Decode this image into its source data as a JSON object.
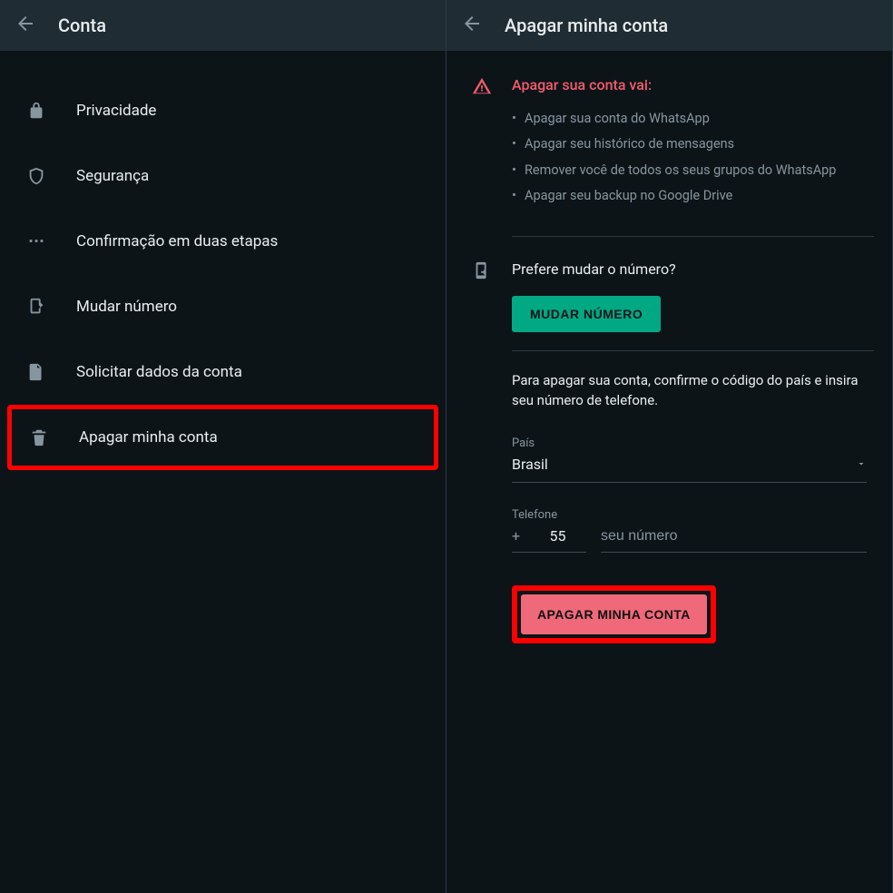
{
  "left": {
    "title": "Conta",
    "items": [
      {
        "label": "Privacidade",
        "icon": "lock-icon"
      },
      {
        "label": "Segurança",
        "icon": "shield-icon"
      },
      {
        "label": "Confirmação em duas etapas",
        "icon": "pin-icon"
      },
      {
        "label": "Mudar número",
        "icon": "send-phone-icon"
      },
      {
        "label": "Solicitar dados da conta",
        "icon": "document-icon"
      },
      {
        "label": "Apagar minha conta",
        "icon": "trash-icon"
      }
    ]
  },
  "right": {
    "title": "Apagar minha conta",
    "warning": {
      "heading": "Apagar sua conta vai:",
      "bullets": [
        "Apagar sua conta do WhatsApp",
        "Apagar seu histórico de mensagens",
        "Remover você de todos os seus grupos do WhatsApp",
        "Apagar seu backup no Google Drive"
      ]
    },
    "change": {
      "prompt": "Prefere mudar o número?",
      "button": "MUDAR NÚMERO"
    },
    "form": {
      "instructions": "Para apagar sua conta, confirme o código do país e insira seu número de telefone.",
      "country_label": "País",
      "country_value": "Brasil",
      "phone_label": "Telefone",
      "plus": "+",
      "cc": "55",
      "phone_placeholder": "seu número",
      "delete_button": "APAGAR MINHA CONTA"
    }
  }
}
